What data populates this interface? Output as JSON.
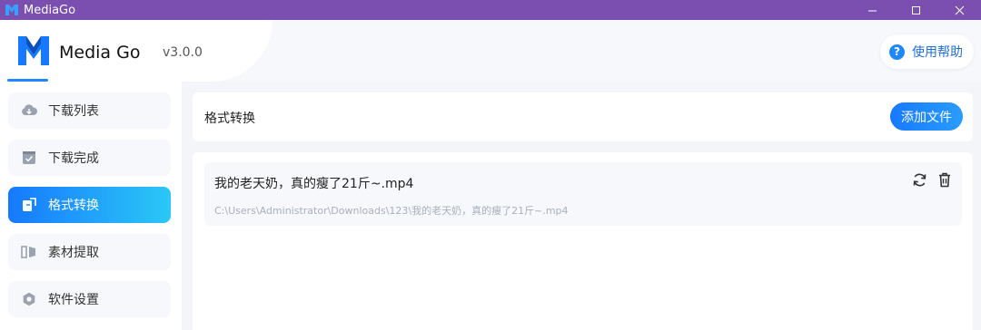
{
  "window": {
    "title": "MediaGo",
    "minimize_glyph": "–",
    "maximize_glyph": "□",
    "close_glyph": "✕"
  },
  "header": {
    "brand": "Media Go",
    "version": "v3.0.0",
    "help_label": "使用帮助",
    "help_icon_glyph": "?"
  },
  "sidebar": {
    "items": [
      {
        "label": "下载列表",
        "icon": "cloud-download-icon",
        "active": false
      },
      {
        "label": "下载完成",
        "icon": "check-box-icon",
        "active": false
      },
      {
        "label": "格式转换",
        "icon": "convert-icon",
        "active": true
      },
      {
        "label": "素材提取",
        "icon": "extract-icon",
        "active": false
      },
      {
        "label": "软件设置",
        "icon": "settings-icon",
        "active": false
      }
    ]
  },
  "main": {
    "panel_title": "格式转换",
    "add_button_label": "添加文件",
    "files": [
      {
        "name": "我的老天奶，真的瘦了21斤~.mp4",
        "path": "C:\\Users\\Administrator\\Downloads\\123\\我的老天奶，真的瘦了21斤~.mp4"
      }
    ]
  },
  "colors": {
    "titlebar": "#7a4fb0",
    "accent": "#1679ff",
    "accent_end": "#2bc8f5"
  }
}
